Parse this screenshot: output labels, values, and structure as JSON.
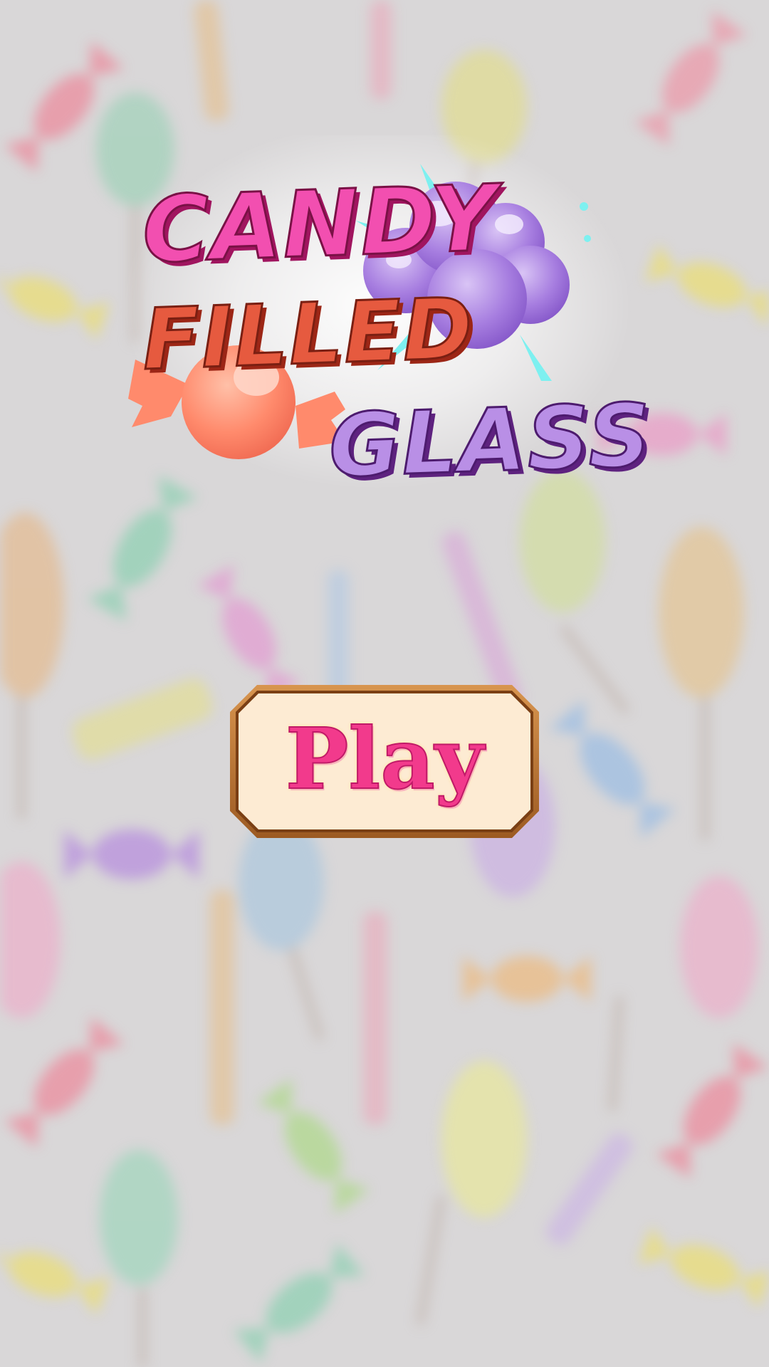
{
  "logo": {
    "line1": "CANDY",
    "line2": "FILLED",
    "line3": "GLASS"
  },
  "play_button": {
    "label": "Play"
  },
  "colors": {
    "background": "#d9d7d8",
    "title_pink": "#f24fb0",
    "title_red": "#e65a3f",
    "title_purple": "#b98fe6",
    "button_fill": "#fdebd3",
    "button_frame": "#b9702e",
    "button_text": "#f23a8c"
  },
  "icons": {
    "background": "blurred-candy-pattern",
    "logo_candy": "wrapped-candy-icon",
    "logo_cloud": "cotton-candy-cloud-icon"
  }
}
